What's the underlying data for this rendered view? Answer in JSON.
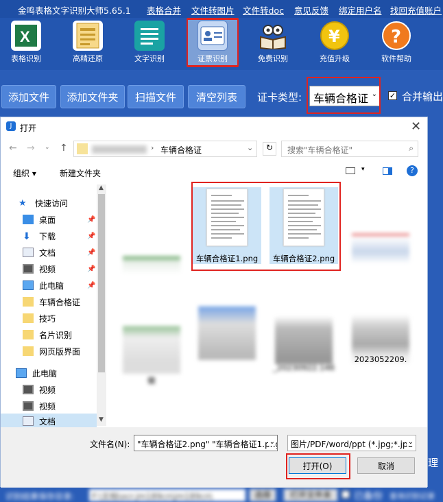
{
  "app": {
    "title": "金鸣表格文字识别大师5.65.1",
    "menu": [
      "表格合并",
      "文件转图片",
      "文件转doc",
      "意见反馈",
      "绑定用户名",
      "找回充值账户"
    ]
  },
  "toolbar": [
    {
      "label": "表格识别",
      "icon": "excel-icon",
      "color": "#1f7a45"
    },
    {
      "label": "高精还原",
      "icon": "document-grid-icon",
      "color": "#f0c060"
    },
    {
      "label": "文字识别",
      "icon": "text-lines-icon",
      "color": "#1aa3a3"
    },
    {
      "label": "证票识别",
      "icon": "id-card-icon",
      "color": "#9fc0ec"
    },
    {
      "label": "免费识别",
      "icon": "book-reader-icon",
      "color": "#efefef"
    },
    {
      "label": "充值升级",
      "icon": "yen-coin-icon",
      "color": "#f2c40f"
    },
    {
      "label": "软件帮助",
      "icon": "help-icon",
      "color": "#f07a1e"
    }
  ],
  "actions": {
    "add_file": "添加文件",
    "add_folder": "添加文件夹",
    "scan": "扫描文件",
    "clear": "清空列表",
    "card_type_label": "证卡类型:",
    "card_type_value": "车辆合格证",
    "merge_label": "合并输出",
    "merge_checked": "✓"
  },
  "dialog": {
    "title": "打开",
    "folder": "车辆合格证",
    "search_placeholder": "搜索\"车辆合格证\"",
    "organize": "组织 ▾",
    "new_folder": "新建文件夹",
    "nav": [
      {
        "label": "快速访问",
        "icon": "star-icon",
        "pin": ""
      },
      {
        "label": "桌面",
        "icon": "desktop-icon",
        "pin": "📌"
      },
      {
        "label": "下载",
        "icon": "download-icon",
        "pin": "📌"
      },
      {
        "label": "文档",
        "icon": "documents-icon",
        "pin": "📌"
      },
      {
        "label": "视频",
        "icon": "video-icon",
        "pin": "📌"
      },
      {
        "label": "此电脑",
        "icon": "computer-icon",
        "pin": "📌"
      },
      {
        "label": "车辆合格证",
        "icon": "folder-icon",
        "pin": ""
      },
      {
        "label": "技巧",
        "icon": "folder-icon",
        "pin": ""
      },
      {
        "label": "名片识别",
        "icon": "folder-icon",
        "pin": ""
      },
      {
        "label": "网页版界面",
        "icon": "folder-icon",
        "pin": ""
      },
      {
        "label": "此电脑",
        "icon": "computer-icon",
        "pin": ""
      },
      {
        "label": "视频",
        "icon": "video-icon",
        "pin": ""
      },
      {
        "label": "视频",
        "icon": "video-icon",
        "pin": ""
      },
      {
        "label": "文档",
        "icon": "documents-icon",
        "pin": ""
      }
    ],
    "files": [
      {
        "name": "",
        "kind": "blurred"
      },
      {
        "name": "车辆合格证1.png",
        "kind": "doc"
      },
      {
        "name": "车辆合格证2.png",
        "kind": "doc"
      },
      {
        "name": "徽",
        "kind": "blurred"
      },
      {
        "name": "",
        "kind": "blurred"
      },
      {
        "name": "",
        "kind": "blurred"
      },
      {
        "name": "_20230922.146",
        "kind": "blurred"
      },
      {
        "name": "2023052209.",
        "kind": "blurred"
      }
    ],
    "filename_label": "文件名(N):",
    "filename_value": "\"车辆合格证2.png\" \"车辆合格证1.png\"",
    "filetype_value": "图片/PDF/word/ppt (*.jpg;*.jpe",
    "open_button": "打开(O)",
    "cancel_button": "取消"
  },
  "side_text": "理",
  "status": {
    "save_label": "识别结果保存目录:",
    "save_path": "F:\\文档\\ocr.jm189cn\\jm189cn\\",
    "browse": "选择",
    "open_folder": "打开文件夹",
    "backup": "已备份",
    "backup_note": "查询识别记录"
  }
}
